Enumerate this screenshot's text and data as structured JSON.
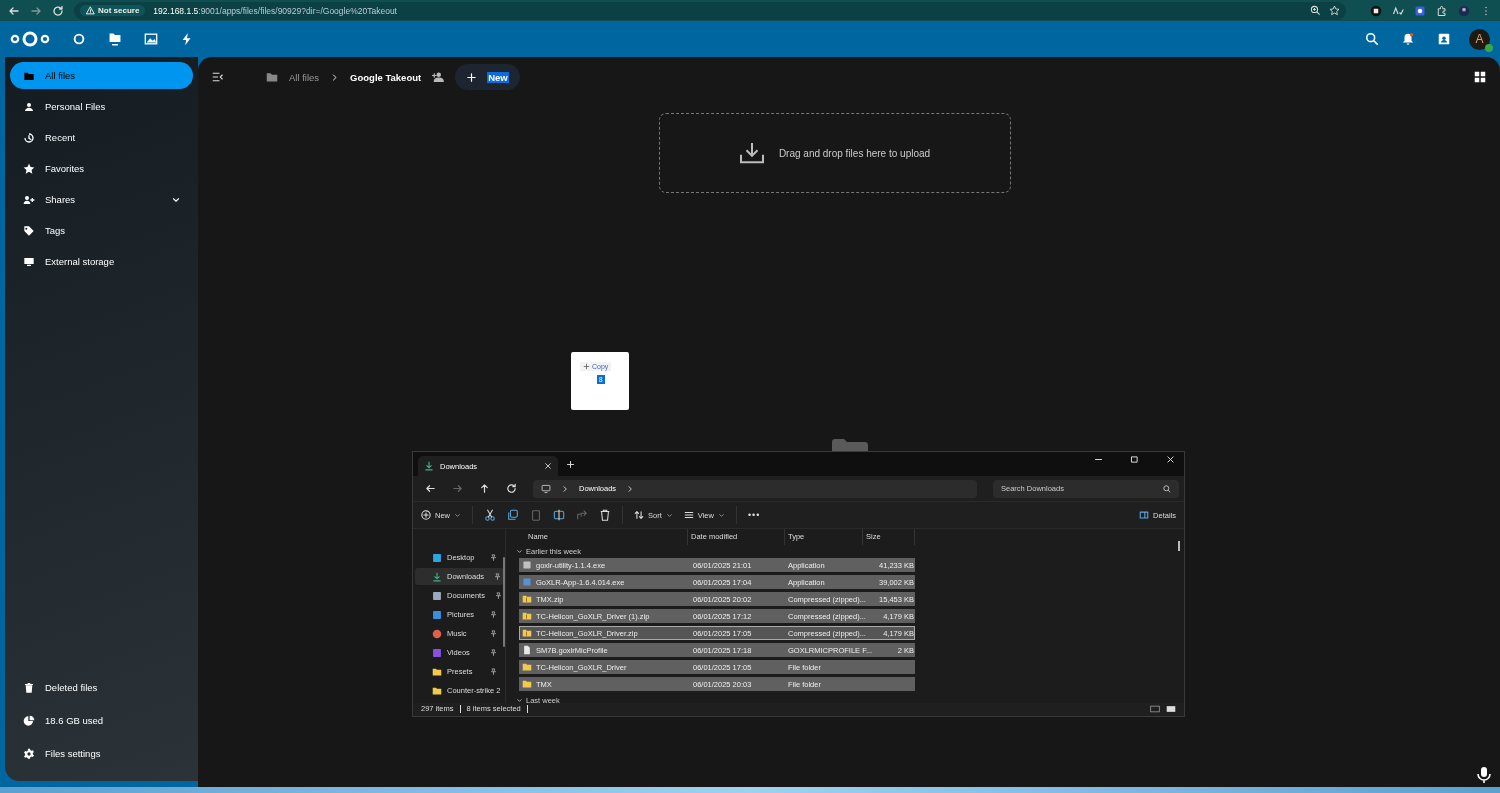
{
  "browser": {
    "security": "Not secure",
    "url_host": "192.168.1.5",
    "url_rest": ":9001/apps/files/files/90929?dir=/Google%20Takeout"
  },
  "sidebar": {
    "items": [
      {
        "label": "All files",
        "selected": true
      },
      {
        "label": "Personal Files",
        "selected": false
      },
      {
        "label": "Recent",
        "selected": false
      },
      {
        "label": "Favorites",
        "selected": false
      },
      {
        "label": "Shares",
        "selected": false
      },
      {
        "label": "Tags",
        "selected": false
      },
      {
        "label": "External storage",
        "selected": false
      }
    ],
    "footer": [
      "Deleted files",
      "18.6 GB used",
      "Files settings"
    ]
  },
  "breadcrumb": {
    "root": "All files",
    "current": "Google Takeout",
    "new_button": "New"
  },
  "avatar": "A",
  "dropzone": "Drag and drop files here to upload",
  "drag_ghost": {
    "action": "Copy",
    "count": "8"
  },
  "explorer": {
    "tab": "Downloads",
    "address": "Downloads",
    "search_placeholder": "Search Downloads",
    "toolbar": {
      "new": "New",
      "sort": "Sort",
      "view": "View",
      "more": "•••",
      "details": "Details"
    },
    "columns": [
      "Name",
      "Date modified",
      "Type",
      "Size"
    ],
    "nav": [
      {
        "label": "Desktop",
        "kind": "desktop",
        "pinned": true,
        "selected": false
      },
      {
        "label": "Downloads",
        "kind": "download",
        "pinned": true,
        "selected": true
      },
      {
        "label": "Documents",
        "kind": "document",
        "pinned": true,
        "selected": false
      },
      {
        "label": "Pictures",
        "kind": "picture",
        "pinned": true,
        "selected": false
      },
      {
        "label": "Music",
        "kind": "music",
        "pinned": true,
        "selected": false
      },
      {
        "label": "Videos",
        "kind": "video",
        "pinned": true,
        "selected": false
      },
      {
        "label": "Presets",
        "kind": "folder",
        "pinned": true,
        "selected": false
      },
      {
        "label": "Counter-strike 2",
        "kind": "folder",
        "pinned": false,
        "selected": false
      }
    ],
    "groups": [
      {
        "label": "Earlier this week",
        "rows": [
          {
            "name": "goxlr-utility-1.1.4.exe",
            "date": "06/01/2025 21:01",
            "type": "Application",
            "size": "41,233 KB",
            "kind": "exe",
            "selected": true,
            "focused": false
          },
          {
            "name": "GoXLR-App-1.6.4.014.exe",
            "date": "06/01/2025 17:04",
            "type": "Application",
            "size": "39,002 KB",
            "kind": "installer",
            "selected": true,
            "focused": false
          },
          {
            "name": "TMX.zip",
            "date": "06/01/2025 20:02",
            "type": "Compressed (zipped)...",
            "size": "15,453 KB",
            "kind": "zip",
            "selected": true,
            "focused": false
          },
          {
            "name": "TC-Helicon_GoXLR_Driver (1).zip",
            "date": "06/01/2025 17:12",
            "type": "Compressed (zipped)...",
            "size": "4,179 KB",
            "kind": "zip",
            "selected": true,
            "focused": false
          },
          {
            "name": "TC-Helicon_GoXLR_Driver.zip",
            "date": "06/01/2025 17:05",
            "type": "Compressed (zipped)...",
            "size": "4,179 KB",
            "kind": "zip",
            "selected": true,
            "focused": true
          },
          {
            "name": "SM7B.goxlrMicProfile",
            "date": "06/01/2025 17:18",
            "type": "GOXLRMICPROFILE F...",
            "size": "2 KB",
            "kind": "file",
            "selected": true,
            "focused": false
          },
          {
            "name": "TC-Helicon_GoXLR_Driver",
            "date": "06/01/2025 17:05",
            "type": "File folder",
            "kind": "folder",
            "selected": true,
            "focused": false
          },
          {
            "name": "TMX",
            "date": "06/01/2025 20:03",
            "type": "File folder",
            "kind": "folder",
            "selected": true,
            "focused": false
          }
        ]
      },
      {
        "label": "Last week"
      }
    ],
    "status": {
      "count": "297 items",
      "selected": "8 items selected"
    }
  }
}
